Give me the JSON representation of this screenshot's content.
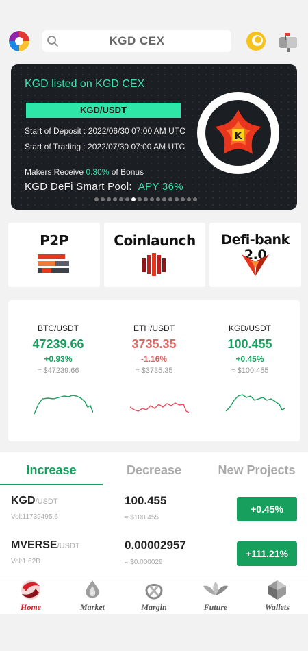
{
  "header": {
    "search_text": "KGD CEX",
    "icons": [
      "app-logo-icon",
      "search-icon",
      "coin-icon",
      "mailbox-icon"
    ]
  },
  "banner": {
    "title": "KGD listed on KGD CEX",
    "pair": "KGD/USDT",
    "deposit_line": "Start of Deposit : 2022/06/30 07:00 AM UTC",
    "trading_line": "Start of Trading : 2022/07/30 07:00 AM UTC",
    "makers_prefix": "Makers Receive ",
    "makers_value": "0.30%",
    "makers_suffix": " of Bonus",
    "pool_label": "KGD DeFi Smart Pool:",
    "pool_apy": "APY 36%",
    "slide_count": 17,
    "active_slide": 6,
    "colors": {
      "accent": "#35e0a9",
      "background": "#1b1e23"
    }
  },
  "features": [
    {
      "label": "P2P",
      "icon": "p2p-icon"
    },
    {
      "label": "Coinlaunch",
      "icon": "coinlaunch-icon"
    },
    {
      "label": "Defi-bank 2.0",
      "icon": "defi-bank-icon"
    }
  ],
  "tickers": [
    {
      "pair": "BTC/USDT",
      "price": "47239.66",
      "change": "+0.93%",
      "usd": "≈ $47239.66",
      "trend": "up"
    },
    {
      "pair": "ETH/USDT",
      "price": "3735.35",
      "change": "-1.16%",
      "usd": "≈ $3735.35",
      "trend": "down"
    },
    {
      "pair": "KGD/USDT",
      "price": "100.455",
      "change": "+0.45%",
      "usd": "≈ $100.455",
      "trend": "up"
    }
  ],
  "tabs": [
    {
      "label": "Increase",
      "active": true
    },
    {
      "label": "Decrease",
      "active": false
    },
    {
      "label": "New Projects",
      "active": false
    }
  ],
  "rows": [
    {
      "symbol": "KGD",
      "quote": "/USDT",
      "vol": "Vol:11739495.6",
      "price": "100.455",
      "usd": "≈ $100.455",
      "change": "+0.45%"
    },
    {
      "symbol": "MVERSE",
      "quote": "/USDT",
      "vol": "Vol:1.62B",
      "price": "0.00002957",
      "usd": "≈ $0.000029",
      "change": "+111.21%"
    }
  ],
  "nav": [
    {
      "label": "Home",
      "active": true,
      "icon": "home-icon"
    },
    {
      "label": "Market",
      "active": false,
      "icon": "market-icon"
    },
    {
      "label": "Margin",
      "active": false,
      "icon": "margin-icon"
    },
    {
      "label": "Future",
      "active": false,
      "icon": "future-icon"
    },
    {
      "label": "Wallets",
      "active": false,
      "icon": "wallets-icon"
    }
  ],
  "colors": {
    "green": "#17a05d",
    "red": "#e06666",
    "nav_active": "#d6202a"
  }
}
